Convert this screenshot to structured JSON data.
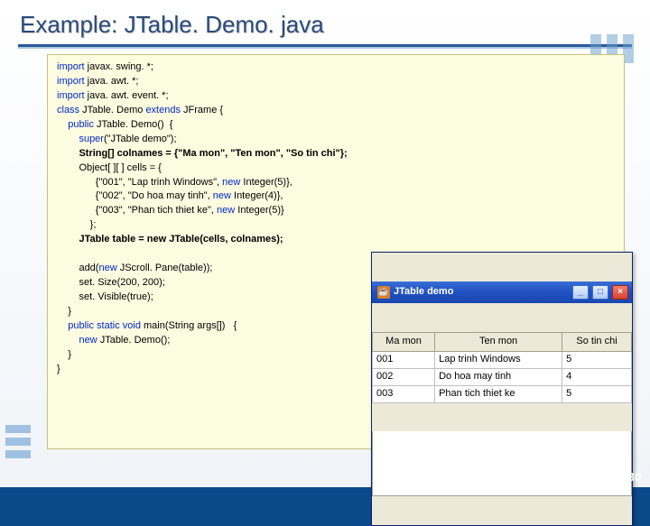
{
  "title": "Example: JTable. Demo. java",
  "page_number": "30",
  "code": {
    "l1a": "import",
    "l1b": " javax. swing. *;",
    "l2a": "import",
    "l2b": " java. awt. *;",
    "l3a": "import",
    "l3b": " java. awt. event. *;",
    "l4a": "class",
    "l4b": " JTable. Demo ",
    "l4c": "extends",
    "l4d": " JFrame {",
    "l5a": "    public",
    "l5b": " JTable. Demo()  {",
    "l6a": "        super",
    "l6b": "(\"JTable demo\");",
    "l7": "        String[] colnames = {\"Ma mon\", \"Ten mon\", \"So tin chi\"};",
    "l8": "        Object[ ][ ] cells = {",
    "l9a": "              {\"001\", \"Lap trinh Windows\", ",
    "l9b": "new",
    "l9c": " Integer(5)},",
    "l10a": "              {\"002\", \"Do hoa may tinh\", ",
    "l10b": "new",
    "l10c": " Integer(4)},",
    "l11a": "              {\"003\", \"Phan tich thiet ke\", ",
    "l11b": "new",
    "l11c": " Integer(5)}",
    "l12": "            };",
    "l13": "        JTable table = new JTable(cells, colnames);",
    "blank": " ",
    "l14a": "        add(",
    "l14b": "new",
    "l14c": " JScroll. Pane(table));",
    "l15": "        set. Size(200, 200);",
    "l16": "        set. Visible(true);",
    "l17": "    }",
    "l18a": "    public static void",
    "l18b": " main(String args[])   {",
    "l19a": "        new",
    "l19b": " JTable. Demo();",
    "l20": "    }",
    "l21": "}"
  },
  "window": {
    "title": "JTable demo",
    "headers": [
      "Ma mon",
      "Ten mon",
      "So tin chi"
    ],
    "rows": [
      [
        "001",
        "Lap trinh Windows",
        "5"
      ],
      [
        "002",
        "Do hoa may tinh",
        "4"
      ],
      [
        "003",
        "Phan tich thiet ke",
        "5"
      ]
    ]
  }
}
